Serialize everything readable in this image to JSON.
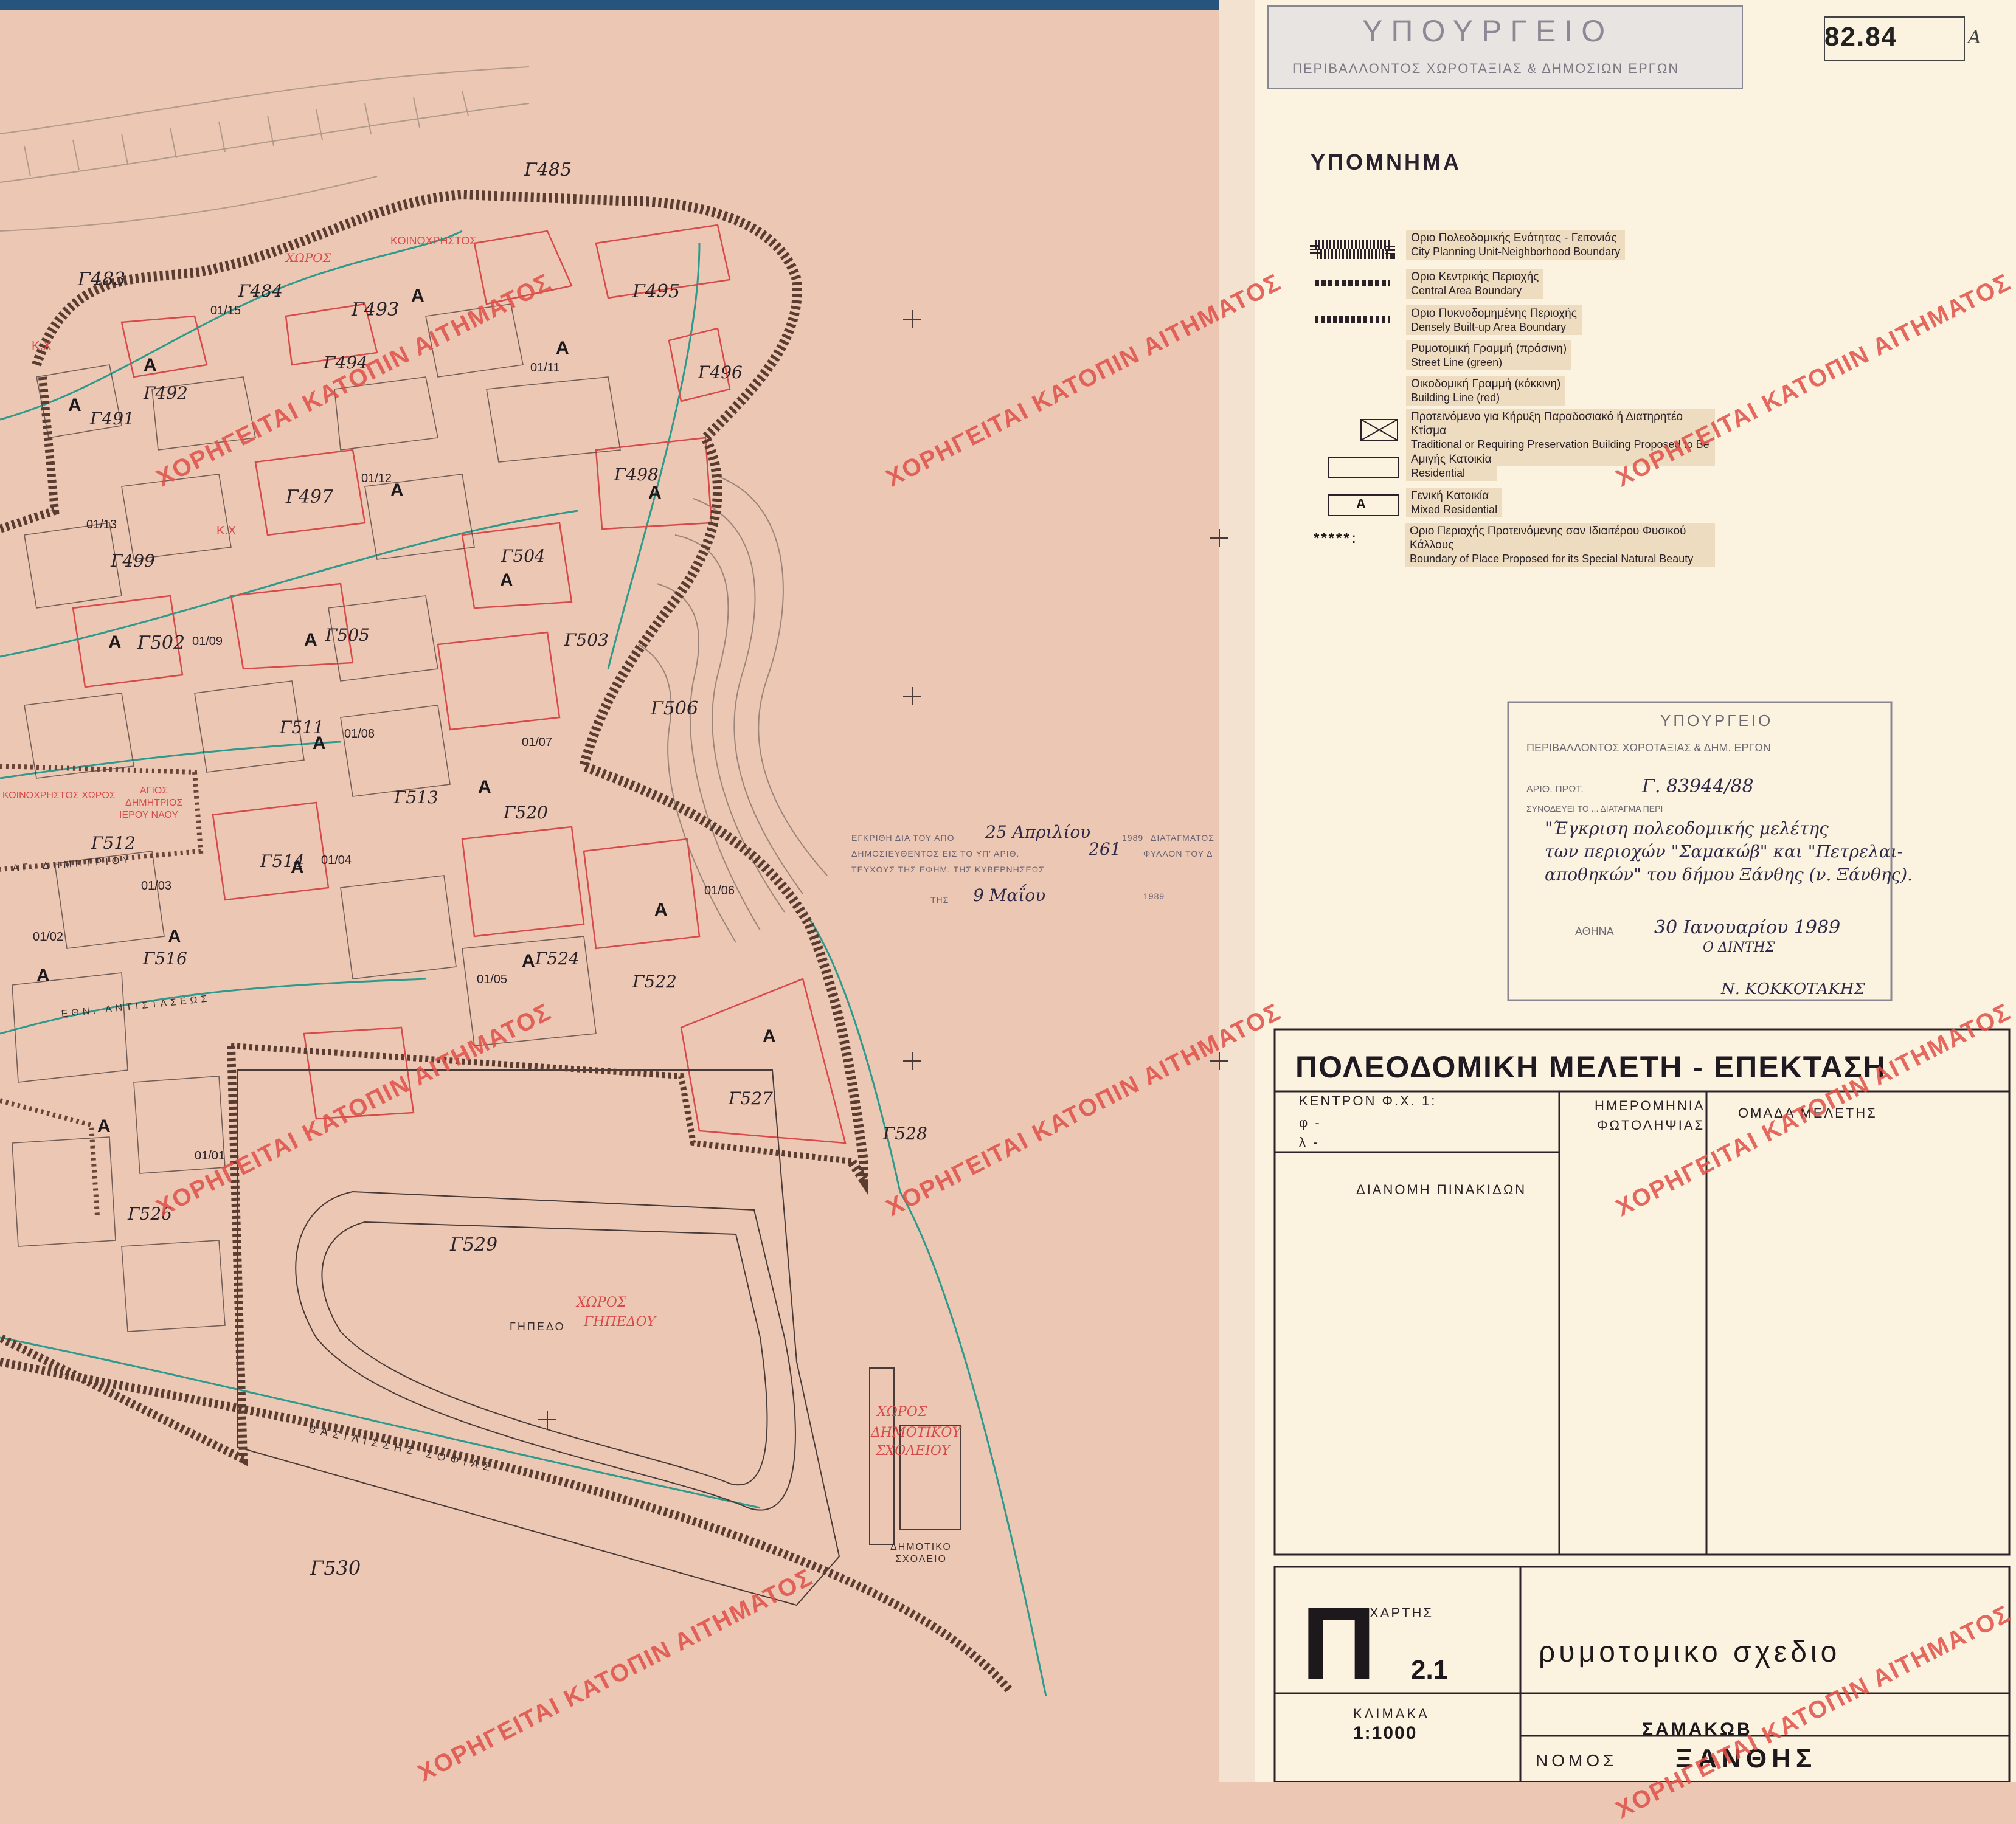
{
  "sheet": {
    "number": "82.84",
    "suffix": "Α"
  },
  "ministry_stamp": {
    "name": "ΥΠΟΥΡΓΕΙΟ",
    "department": "ΠΕΡΙΒΑΛΛΟΝΤΟΣ ΧΩΡΟΤΑΞΙΑΣ & ΔΗΜΟΣΙΩΝ ΕΡΓΩΝ"
  },
  "legend": {
    "title": "ΥΠΟΜΝΗΜΑ",
    "items": [
      {
        "el": "Οριο Πολεοδομικής Ενότητας - Γειτονιάς",
        "en": "City Planning Unit-Neighborhood Boundary",
        "symbol": "hatched-band"
      },
      {
        "el": "Οριο Κεντρικής Περιοχής",
        "en": "Central Area Boundary",
        "symbol": "dashed-band"
      },
      {
        "el": "Οριο Πυκνοδομημένης Περιοχής",
        "en": "Densely Built-up Area Boundary",
        "symbol": "dotted-band"
      },
      {
        "el": "Ρυμοτομική Γραμμή (πράσινη)",
        "en": "Street Line (green)",
        "symbol": "none"
      },
      {
        "el": "Οικοδομική Γραμμή (κόκκινη)",
        "en": "Building Line (red)",
        "symbol": "none"
      },
      {
        "el": "Προτεινόμενο για Κήρυξη Παραδοσιακό ή Διατηρητέο Κτίσμα",
        "en": "Traditional or Requiring Preservation Building Proposed to Be Listed",
        "symbol": "crossed-box"
      },
      {
        "el": "Αμιγής Κατοικία",
        "en": "Residential",
        "symbol": "empty-box"
      },
      {
        "el": "Γενική Κατοικία",
        "en": "Mixed Residential",
        "symbol": "a-box",
        "symbol_text": "Α"
      },
      {
        "el": "Οριο Περιοχής Προτεινόμενης σαν Ιδιαιτέρου Φυσικού Κάλλους",
        "en": "Boundary of Place Proposed for its Special Natural Beauty",
        "symbol": "stars",
        "symbol_text": "*****:"
      }
    ]
  },
  "approval": {
    "line1": "ΕΓΚΡΙΘΗ ΔΙΑ ΤΟΥ ΑΠΟ",
    "date_hand": "25 Απριλίου",
    "year1": "1989",
    "line1_end": "ΔΙΑΤΑΓΜΑΤΟΣ",
    "line2": "ΔΗΜΟΣΙΕΥΘΕΝΤΟΣ ΕΙΣ ΤΟ ΥΠ' ΑΡΙΘ.",
    "issue_hand": "261",
    "line2_end": "ΦΥΛΛΟΝ ΤΟΥ Δ",
    "line3": "ΤΕΥΧΟΥΣ ΤΗΣ ΕΦΗΜ. ΤΗΣ ΚΥΒΕΡΝΗΣΕΩΣ",
    "line4": "ΤΗΣ",
    "pub_date_hand": "9 Μαΐου",
    "year2": "1989"
  },
  "approval_stamp": {
    "header": "ΥΠΟΥΡΓΕΙΟ",
    "sub": "ΠΕΡΙΒΑΛΛΟΝΤΟΣ ΧΩΡΟΤΑΞΙΑΣ & ΔΗΜ. ΕΡΓΩΝ",
    "ref_label": "ΑΡΙΘ. ΠΡΩΤ.",
    "ref_hand": "Γ. 83944/88",
    "attach_label": "ΣΥΝΟΔΕΥΕΙ ΤΟ ... ΔΙΑΤΑΓΜΑ ΠΕΡΙ",
    "desc_hand_1": "\"Έγκριση πολεοδομικής μελέτης",
    "desc_hand_2": "των περιοχών \"Σαμακώβ\" και \"Πετρελαι-",
    "desc_hand_3": "αποθηκών\" του δήμου Ξάνθης (ν. Ξάνθης).",
    "city_label": "ΑΘΗΝΑ",
    "date_hand": "30 Ιανουαρίου 1989",
    "role": "Ο ΔΙΝΤΗΣ",
    "signature": "Ν. ΚΟΚΚΟΤΑΚΗΣ"
  },
  "title_block": {
    "title": "ΠΟΛΕΟΔΟΜΙΚΗ ΜΕΛΕΤΗ - ΕΠΕΚΤΑΣΗ",
    "center_label": "ΚΕΝΤΡΟΝ Φ.Χ. 1:",
    "phi": "φ -",
    "lambda": "λ -",
    "photo_date_1": "ΗΜΕΡΟΜΗΝΙΑ",
    "photo_date_2": "ΦΩΤΟΛΗΨΙΑΣ",
    "team": "ΟΜΑΔΑ ΜΕΛΕΤΗΣ",
    "distribution": "ΔΙΑΝΟΜΗ ΠΙΝΑΚΙΔΩΝ",
    "map_label": "ΧΑΡΤΗΣ",
    "map_letter": "Π",
    "map_number": "2.1",
    "subject": "ρυμοτομικο σχεδιο",
    "scale_label": "ΚΛΙΜΑΚΑ",
    "scale": "1:1000",
    "place": "ΣΑΜΑΚΩΒ",
    "prefecture_label": "ΝΟΜΟΣ",
    "prefecture": "ΞΑΝΘΗΣ"
  },
  "watermark_text": "ΧΟΡΗΓΕΙΤΑΙ ΚΑΤΟΠΙΝ ΑΙΤΗΜΑΤΟΣ",
  "map": {
    "blocks": [
      "Γ483",
      "Γ484",
      "Γ485",
      "Γ491",
      "Γ492",
      "Γ493",
      "Γ494",
      "Γ495",
      "Γ496",
      "Γ497",
      "Γ498",
      "Γ499",
      "Γ502",
      "Γ503",
      "Γ504",
      "Γ505",
      "Γ506",
      "Γ511",
      "Γ512",
      "Γ513",
      "Γ514",
      "Γ516",
      "Γ520",
      "Γ522",
      "Γ524",
      "Γ526",
      "Γ527",
      "Γ528",
      "Γ529",
      "Γ530"
    ],
    "zone_codes": [
      "01/15",
      "01/11",
      "01/12",
      "01/13",
      "01/09",
      "01/08",
      "01/07",
      "01/04",
      "01/03",
      "01/02",
      "01/05",
      "01/06",
      "01/01"
    ],
    "streets": [
      "ΒΑΣΙΛΙΣΣΗΣ ΣΟΦΙΑΣ",
      "ΕΘΝ. ΑΝΤΙΣΤΑΣΕΩΣ",
      "ΑΓ. ΔΗΜΗΤΡΙΟΥ"
    ],
    "labels": {
      "common_space": "ΚΟΙΝΟΧΡΗΣΤΟΣ",
      "space": "ΧΩΡΟΣ",
      "kx": "Κ.Χ",
      "stadium_space": "ΧΩΡΟΣ",
      "stadium_word": "ΓΗΠΕΔΟΥ",
      "stadium_black": "ΓΗΠΕΔΟ",
      "school_space": "ΧΩΡΟΣ",
      "school_word1": "ΔΗΜΟΤΙΚΟΥ",
      "school_word2": "ΣΧΟΛΕΙΟΥ",
      "school_black1": "ΔΗΜΟΤΙΚΟ",
      "school_black2": "ΣΧΟΛΕΙΟ",
      "church_space": "ΚΟΙΝΟΧΡΗΣΤΟΣ ΧΩΡΟΣ",
      "church1": "ΑΓΙΟΣ",
      "church2": "ΔΗΜΗΤΡΙΟΣ",
      "church3": "ΙΕΡΟΥ ΝΑΟΥ",
      "mixed": "Α"
    }
  }
}
